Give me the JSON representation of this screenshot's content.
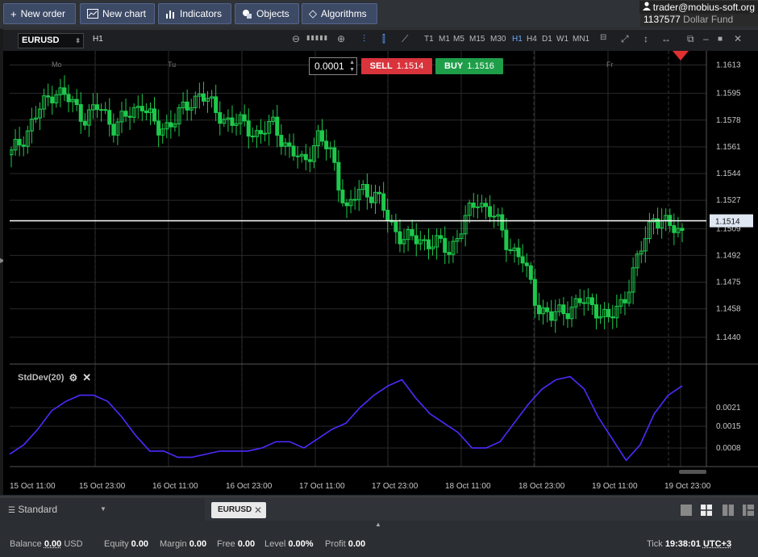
{
  "toolbar": {
    "new_order": "New order",
    "new_chart": "New chart",
    "indicators": "Indicators",
    "objects": "Objects",
    "algorithms": "Algorithms"
  },
  "account": {
    "email": "trader@mobius-soft.org",
    "id": "1137577",
    "fund": "Dollar Fund"
  },
  "chart_toolbar": {
    "symbol": "EURUSD",
    "timeframe_label": "H1",
    "timeframes": [
      "T1",
      "M1",
      "M5",
      "M15",
      "M30",
      "H1",
      "H4",
      "D1",
      "W1",
      "MN1"
    ],
    "active_timeframe": "H1"
  },
  "trade": {
    "lot": "0.0001",
    "sell_label": "SELL",
    "sell_price": "1.1514",
    "buy_label": "BUY",
    "buy_price": "1.1516"
  },
  "indicator": {
    "name": "StdDev(20)"
  },
  "chart_data": [
    {
      "type": "candlestick",
      "symbol": "EURUSD",
      "timeframe": "H1",
      "day_labels": [
        "Mo",
        "Tu",
        "Fr"
      ],
      "y_ticks": [
        "1.1613",
        "1.1595",
        "1.1578",
        "1.1561",
        "1.1544",
        "1.1527",
        "1.1509",
        "1.1492",
        "1.1475",
        "1.1458",
        "1.1440"
      ],
      "ylim": [
        1.1425,
        1.1622
      ],
      "current_price": "1.1514",
      "x_ticks": [
        "15 Oct 11:00",
        "15 Oct 23:00",
        "16 Oct 11:00",
        "16 Oct 23:00",
        "17 Oct 11:00",
        "17 Oct 23:00",
        "18 Oct 11:00",
        "18 Oct 23:00",
        "19 Oct 11:00",
        "19 Oct 23:00"
      ],
      "close_path": [
        1.1556,
        1.157,
        1.1585,
        1.1598,
        1.159,
        1.158,
        1.1586,
        1.1575,
        1.158,
        1.159,
        1.157,
        1.1578,
        1.1585,
        1.1597,
        1.1582,
        1.1578,
        1.1574,
        1.1569,
        1.1575,
        1.156,
        1.155,
        1.1568,
        1.1555,
        1.152,
        1.1535,
        1.153,
        1.1512,
        1.1502,
        1.1502,
        1.15,
        1.1495,
        1.1512,
        1.1528,
        1.1518,
        1.15,
        1.149,
        1.1462,
        1.1452,
        1.1458,
        1.1462,
        1.146,
        1.145,
        1.1465,
        1.149,
        1.1518,
        1.151,
        1.1508
      ]
    },
    {
      "type": "line",
      "series": [
        {
          "name": "StdDev(20)",
          "values": [
            0.0006,
            0.0009,
            0.0014,
            0.002,
            0.0023,
            0.0025,
            0.0025,
            0.0023,
            0.0018,
            0.0012,
            0.0007,
            0.0007,
            0.0005,
            0.0005,
            0.0006,
            0.0007,
            0.0007,
            0.0007,
            0.0008,
            0.001,
            0.001,
            0.0008,
            0.0011,
            0.0014,
            0.0016,
            0.0021,
            0.0025,
            0.0028,
            0.003,
            0.0024,
            0.0019,
            0.0016,
            0.0013,
            0.0008,
            0.0008,
            0.001,
            0.0016,
            0.0022,
            0.0027,
            0.003,
            0.0031,
            0.0027,
            0.0018,
            0.0011,
            0.0004,
            0.0009,
            0.0019,
            0.0025,
            0.0028
          ]
        }
      ],
      "y_ticks": [
        "0.0021",
        "0.0015",
        "0.0008"
      ],
      "ylim": [
        0.0002,
        0.0034
      ]
    }
  ],
  "bottom": {
    "layout": "Standard",
    "chart_tab": "EURUSD"
  },
  "status": {
    "balance_label": "Balance",
    "balance_value": "0.00",
    "balance_ccy": "USD",
    "equity_label": "Equity",
    "equity_value": "0.00",
    "margin_label": "Margin",
    "margin_value": "0.00",
    "free_label": "Free",
    "free_value": "0.00",
    "level_label": "Level",
    "level_value": "0.00%",
    "profit_label": "Profit",
    "profit_value": "0.00",
    "tick_label": "Tick",
    "time": "19:38:01",
    "tz": "UTC+3"
  },
  "colors": {
    "bull": "#1ec94c",
    "bear": "#1ec94c",
    "sell": "#d9333b",
    "buy": "#1f9e4a",
    "indicator_line": "#4b2cff",
    "price_line": "#ffffff"
  }
}
